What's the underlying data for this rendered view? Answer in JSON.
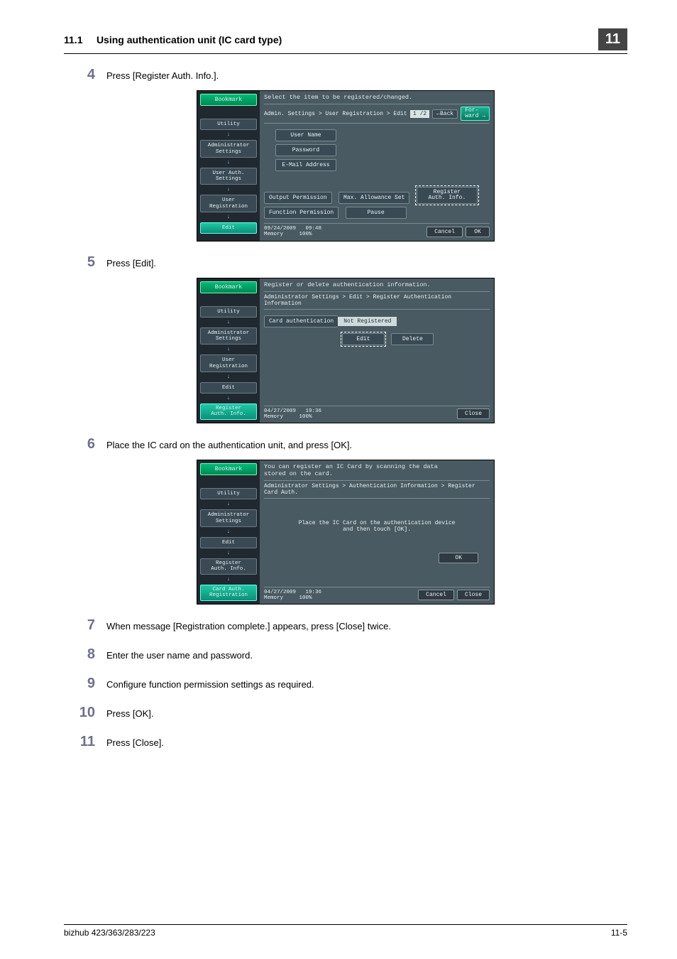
{
  "header": {
    "section_num": "11.1",
    "section_title": "Using authentication unit (IC card type)",
    "chapter_badge": "11"
  },
  "steps": {
    "s4": {
      "num": "4",
      "text": "Press [Register Auth. Info.]."
    },
    "s5": {
      "num": "5",
      "text": "Press [Edit]."
    },
    "s6": {
      "num": "6",
      "text": "Place the IC card on the authentication unit, and press [OK]."
    },
    "s7": {
      "num": "7",
      "text": "When message [Registration complete.] appears, press [Close] twice."
    },
    "s8": {
      "num": "8",
      "text": "Enter the user name and password."
    },
    "s9": {
      "num": "9",
      "text": "Configure function permission settings as required."
    },
    "s10": {
      "num": "10",
      "text": "Press [OK]."
    },
    "s11": {
      "num": "11",
      "text": "Press [Close]."
    }
  },
  "screen1": {
    "title": "Select the item to be registered/changed.",
    "breadcrumb": "Admin. Settings > User Registration > Edit",
    "page": "1 /2",
    "back": "←Back",
    "fwd": "For-\nward →",
    "side": {
      "bookmark": "Bookmark",
      "utility": "Utility",
      "admin": "Administrator\nSettings",
      "uauth": "User Auth.\nSettings",
      "ureg": "User\nRegistration",
      "edit": "Edit"
    },
    "fields": {
      "user_name": "User Name",
      "password": "Password",
      "email": "E-Mail Address",
      "output": "Output Permission",
      "max": "Max. Allowance Set",
      "regauth": "Register\nAuth. Info.",
      "func": "Function Permission",
      "pause": "Pause"
    },
    "footer": {
      "date": "09/24/2009",
      "time": "09:48",
      "mem": "Memory",
      "pct": "100%",
      "cancel": "Cancel",
      "ok": "OK"
    }
  },
  "screen2": {
    "title": "Register or delete authentication information.",
    "breadcrumb": "Administrator Settings > Edit > Register Authentication Information",
    "side": {
      "bookmark": "Bookmark",
      "utility": "Utility",
      "admin": "Administrator\nSettings",
      "ureg": "User\nRegistration",
      "edit": "Edit",
      "regauth": "Register\nAuth. Info."
    },
    "card_label": "Card authentication",
    "card_value": "Not Registered",
    "edit_btn": "Edit",
    "delete_btn": "Delete",
    "footer": {
      "date": "04/27/2009",
      "time": "19:36",
      "mem": "Memory",
      "pct": "100%",
      "close": "Close"
    }
  },
  "screen3": {
    "title": "You can register an IC Card by scanning the data\nstored on the card.",
    "breadcrumb": "Administrator Settings > Authentication Information > Register Card Auth.",
    "side": {
      "bookmark": "Bookmark",
      "utility": "Utility",
      "admin": "Administrator\nSettings",
      "edit": "Edit",
      "regauth": "Register\nAuth. Info.",
      "cardauth": "Card Auth.\nRegistration"
    },
    "center": "Place the IC Card on the authentication device\nand then touch [OK].",
    "ok": "OK",
    "footer": {
      "date": "04/27/2009",
      "time": "19:36",
      "mem": "Memory",
      "pct": "100%",
      "cancel": "Cancel",
      "close": "Close"
    }
  },
  "footer": {
    "left": "bizhub 423/363/283/223",
    "right": "11-5"
  }
}
